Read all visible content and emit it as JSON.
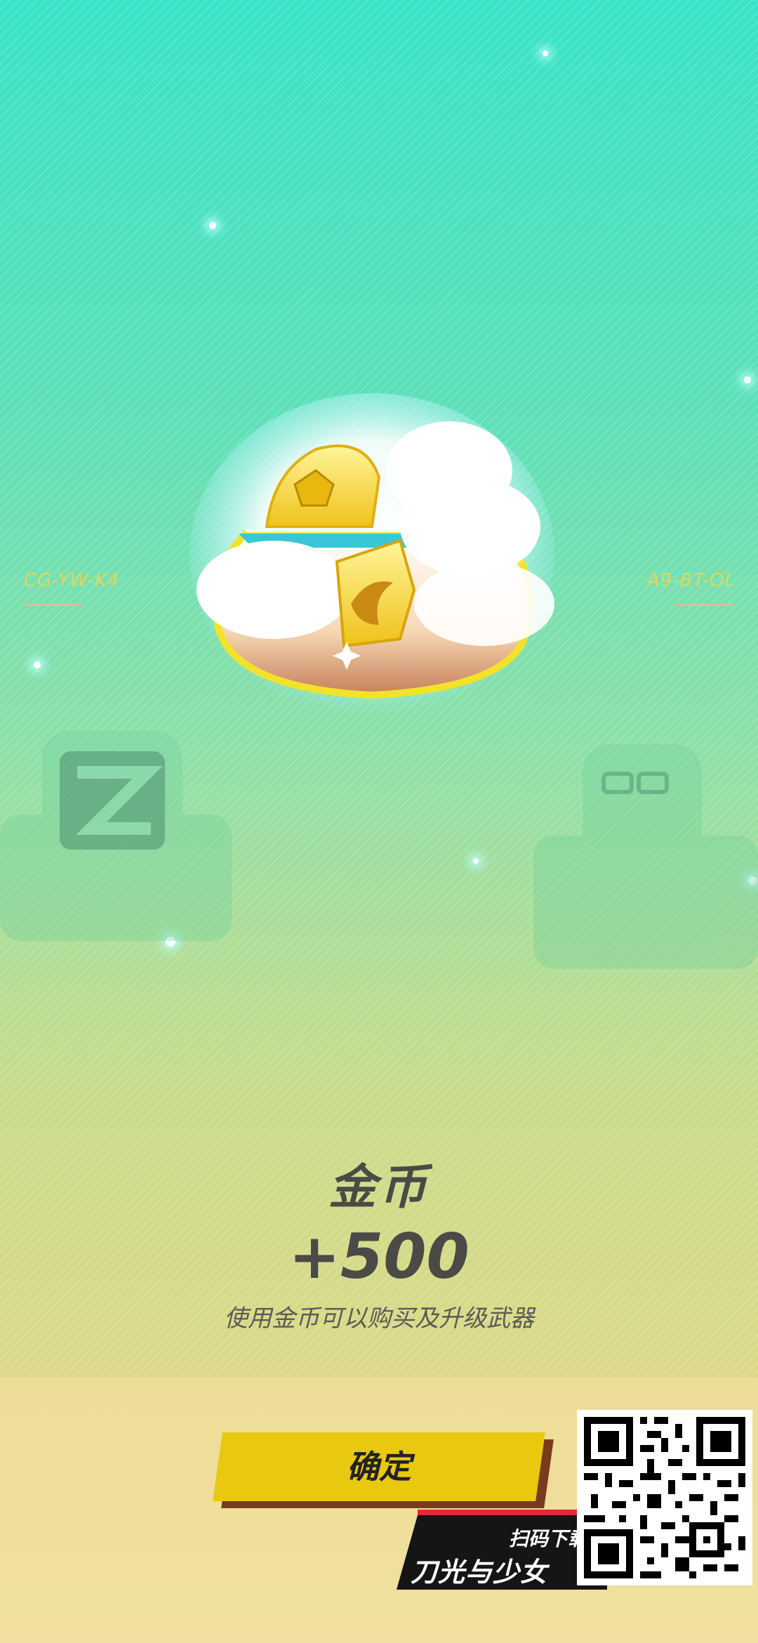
{
  "left_code": "CG-YW-K4",
  "right_code": "A9-BT-OL",
  "reward": {
    "name": "金币",
    "amount": "+500",
    "description": "使用金币可以购买及升级武器",
    "icon": "gold-coin-bag-icon"
  },
  "confirm_button": {
    "label": "确定"
  },
  "promo": {
    "scan_text": "扫码下载",
    "game_name": "刀光与少女",
    "qr": "qr-code"
  },
  "colors": {
    "accent_button": "#e9c90f",
    "text_dark": "#4a4a46",
    "code_label": "#e3d65a"
  }
}
